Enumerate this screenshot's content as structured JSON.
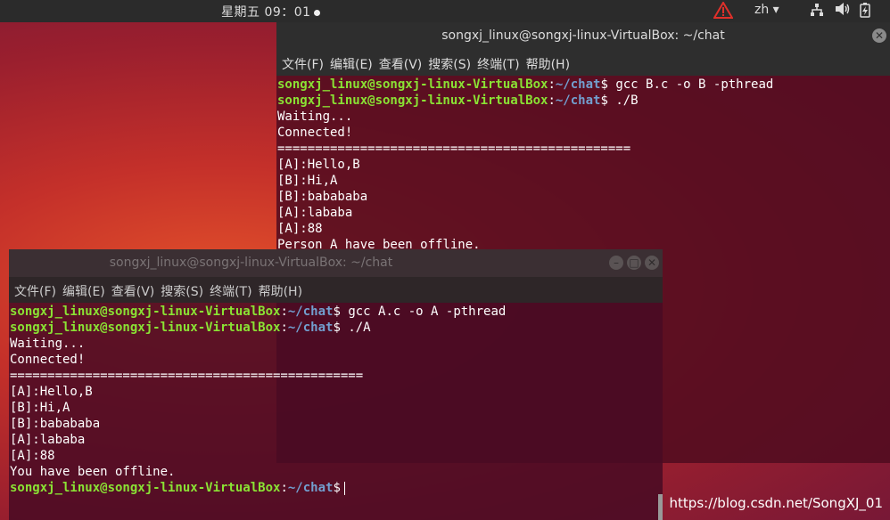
{
  "topbar": {
    "clock": "星期五 09：01",
    "lang": "zh ▾",
    "icons": [
      "warning-icon",
      "network-icon",
      "volume-icon",
      "battery-icon"
    ]
  },
  "menu": [
    "文件(F)",
    "编辑(E)",
    "查看(V)",
    "搜索(S)",
    "终端(T)",
    "帮助(H)"
  ],
  "window_b": {
    "title": "songxj_linux@songxj-linux-VirtualBox: ~/chat",
    "prompt_user": "songxj_linux@songxj-linux-VirtualBox",
    "prompt_path": "~/chat",
    "cmd1": " gcc B.c -o B -pthread",
    "cmd2": " ./B",
    "lines": [
      "Waiting...",
      "Connected!",
      "===============================================",
      "[A]:Hello,B",
      "[B]:Hi,A",
      "[B]:babababa",
      "[A]:lababa",
      "[A]:88",
      "Person A have been offline."
    ]
  },
  "window_a": {
    "title": "songxj_linux@songxj-linux-VirtualBox: ~/chat",
    "prompt_user": "songxj_linux@songxj-linux-VirtualBox",
    "prompt_path": "~/chat",
    "cmd1": " gcc A.c -o A -pthread",
    "cmd2": " ./A",
    "lines": [
      "Waiting...",
      "Connected!",
      "===============================================",
      "[A]:Hello,B",
      "[B]:Hi,A",
      "[B]:babababa",
      "[A]:lababa",
      "[A]:88",
      "You have been offline."
    ]
  },
  "watermark": "https://blog.csdn.net/SongXJ_01"
}
